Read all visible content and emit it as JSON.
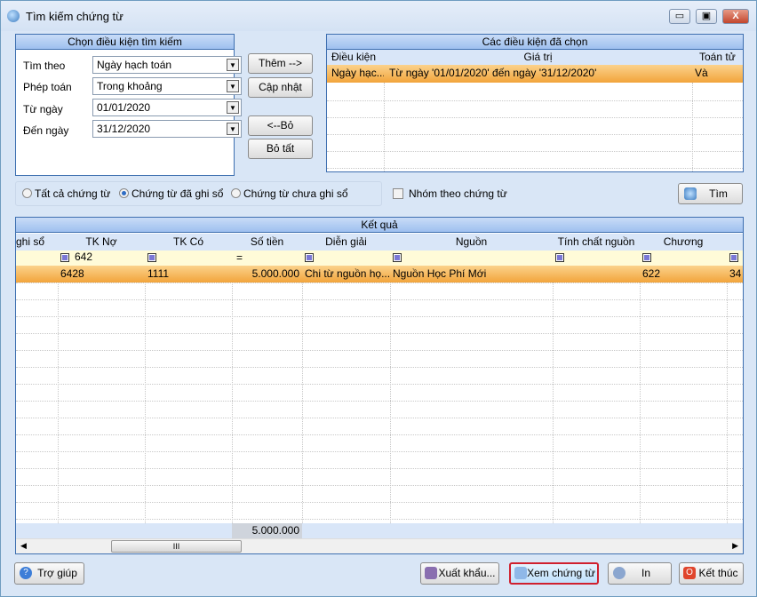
{
  "window": {
    "title": "Tìm kiếm chứng từ",
    "minimize": "▭",
    "maximize": "▣",
    "close": "X"
  },
  "criteria": {
    "title": "Chọn điều kiện tìm kiếm",
    "fields": [
      {
        "label": "Tìm theo",
        "value": "Ngày hạch toán"
      },
      {
        "label": "Phép toán",
        "value": "Trong khoảng"
      },
      {
        "label": "Từ ngày",
        "value": "01/01/2020"
      },
      {
        "label": "Đến ngày",
        "value": "31/12/2020"
      }
    ]
  },
  "actions": {
    "add": "Thêm -->",
    "update": "Cập nhật",
    "remove": "<--Bỏ",
    "remove_all": "Bỏ tất"
  },
  "selected": {
    "title": "Các điều kiện đã chọn",
    "columns": [
      "Điều kiện",
      "Giá trị",
      "Toán tử"
    ],
    "rows": [
      [
        "Ngày hạc...",
        "Từ ngày '01/01/2020' đến ngày '31/12/2020'",
        "Và"
      ]
    ]
  },
  "filter": {
    "options": [
      "Tất cả chứng từ",
      "Chứng từ đã ghi sổ",
      "Chứng từ chưa ghi sổ"
    ],
    "selected_index": 1,
    "group_label": "Nhóm theo chứng từ",
    "group_checked": false,
    "search": "Tìm"
  },
  "results": {
    "title": "Kết quả",
    "columns": [
      "ghi sổ",
      "TK Nợ",
      "TK Có",
      "Số tiền",
      "Diễn giải",
      "Nguồn",
      "Tính chất nguồn",
      "Chương"
    ],
    "filter_row": {
      "tk_no": "642",
      "so_tien_op": "="
    },
    "rows": [
      [
        "",
        "6428",
        "1111",
        "5.000.000",
        "Chi từ nguồn họ...",
        "Nguồn Học Phí Mới",
        "",
        "622",
        "34"
      ]
    ],
    "total": "5.000.000",
    "scroll_thumb": "III"
  },
  "footer": {
    "help": "Trợ giúp",
    "export": "Xuất khẩu...",
    "view": "Xem chứng từ",
    "print": "In",
    "exit": "Kết thúc"
  }
}
